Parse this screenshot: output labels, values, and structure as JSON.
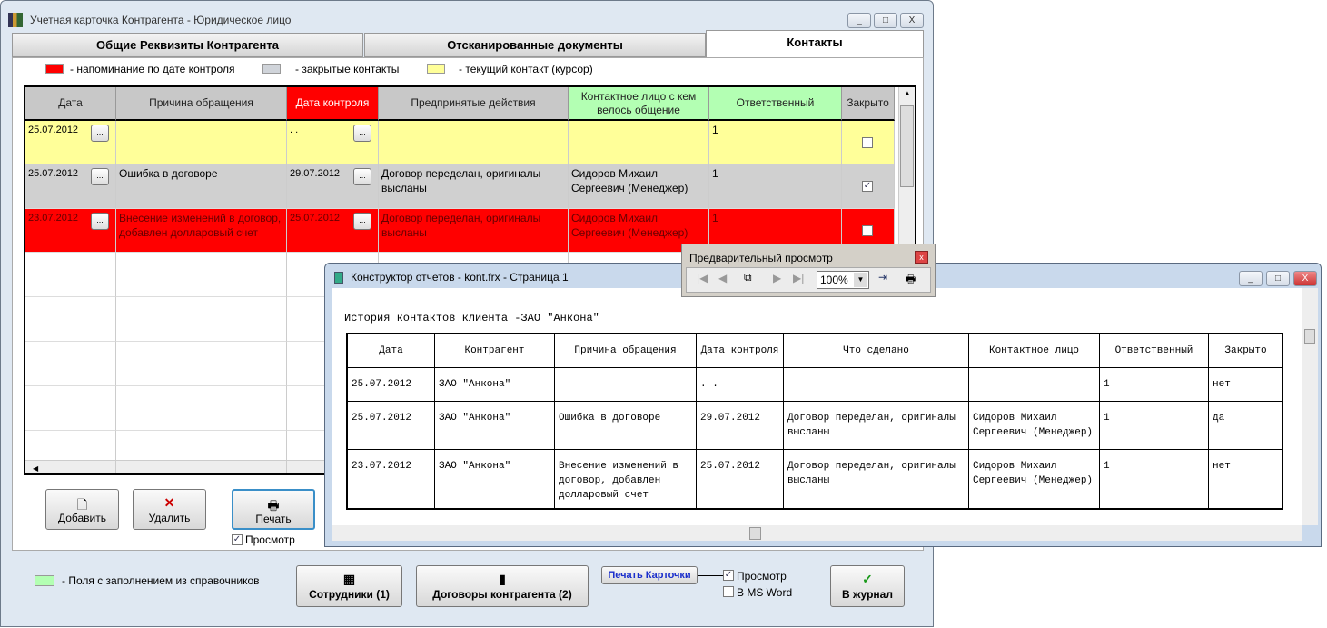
{
  "window": {
    "title": "Учетная карточка Контрагента - Юридическое лицо",
    "controls": [
      "_",
      "□",
      "X"
    ]
  },
  "tabs": [
    {
      "label": "Общие Реквизиты Контрагента"
    },
    {
      "label": "Отсканированные документы"
    },
    {
      "label": "Контакты",
      "active": true
    }
  ],
  "legend": {
    "red": "- напоминание по дате контроля",
    "gray": "- закрытые контакты",
    "yellow": "- текущий контакт (курсор)",
    "green": "- Поля с заполнением из справочников",
    "colors": {
      "red": "#ff0000",
      "gray": "#d0d0d0",
      "yellow": "#ffff99",
      "green": "#b3ffb3"
    }
  },
  "grid": {
    "columns": [
      "Дата",
      "Причина обращения",
      "Дата контроля",
      "Предпринятые действия",
      "Контактное лицо с кем велось общение",
      "Ответственный",
      "Закрыто"
    ],
    "rows": [
      {
        "date": "25.07.2012",
        "reason": "",
        "control": ". .",
        "actions": "",
        "contact": "",
        "resp": "1",
        "closed": false,
        "color": "#ffff99"
      },
      {
        "date": "25.07.2012",
        "reason": "Ошибка в договоре",
        "control": "29.07.2012",
        "actions": "Договор переделан, оригиналы высланы",
        "contact": "Сидоров Михаил Сергеевич (Менеджер)",
        "resp": "1",
        "closed": true,
        "color": "#d0d0d0"
      },
      {
        "date": "23.07.2012",
        "reason": "Внесение изменений в договор, добавлен долларовый счет",
        "control": "25.07.2012",
        "actions": "Договор переделан, оригиналы высланы",
        "contact": "Сидоров Михаил Сергеевич (Менеджер)",
        "resp": "1",
        "closed": false,
        "color": "#ff0000"
      }
    ]
  },
  "buttons": {
    "add": "Добавить",
    "delete": "Удалить",
    "print": "Печать",
    "preview": "Просмотр",
    "dots": "...",
    "staff": "Сотрудники (1)",
    "contracts": "Договоры контрагента (2)",
    "print_card": "Печать Карточки",
    "card_preview": "Просмотр",
    "ms_word": "В MS Word",
    "journal": "В журнал"
  },
  "preview_toolbar": {
    "title": "Предварительный просмотр",
    "zoom": "100%"
  },
  "report": {
    "window_title": "Конструктор отчетов - kont.frx - Страница 1",
    "heading": "История контактов клиента -ЗАО \"Анкона\"",
    "columns": [
      "Дата",
      "Контрагент",
      "Причина обращения",
      "Дата контроля",
      "Что сделано",
      "Контактное лицо",
      "Ответственный",
      "Закрыто"
    ],
    "rows": [
      [
        "25.07.2012",
        "ЗАО \"Анкона\"",
        "",
        ". .",
        "",
        "",
        "1",
        "нет"
      ],
      [
        "25.07.2012",
        "ЗАО \"Анкона\"",
        "Ошибка в договоре",
        "29.07.2012",
        "Договор переделан, оригиналы высланы",
        "Сидоров Михаил Сергеевич (Менеджер)",
        "1",
        "да"
      ],
      [
        "23.07.2012",
        "ЗАО \"Анкона\"",
        "Внесение изменений в договор, добавлен долларовый счет",
        "25.07.2012",
        "Договор переделан, оригиналы высланы",
        "Сидоров Михаил Сергеевич (Менеджер)",
        "1",
        "нет"
      ]
    ]
  }
}
